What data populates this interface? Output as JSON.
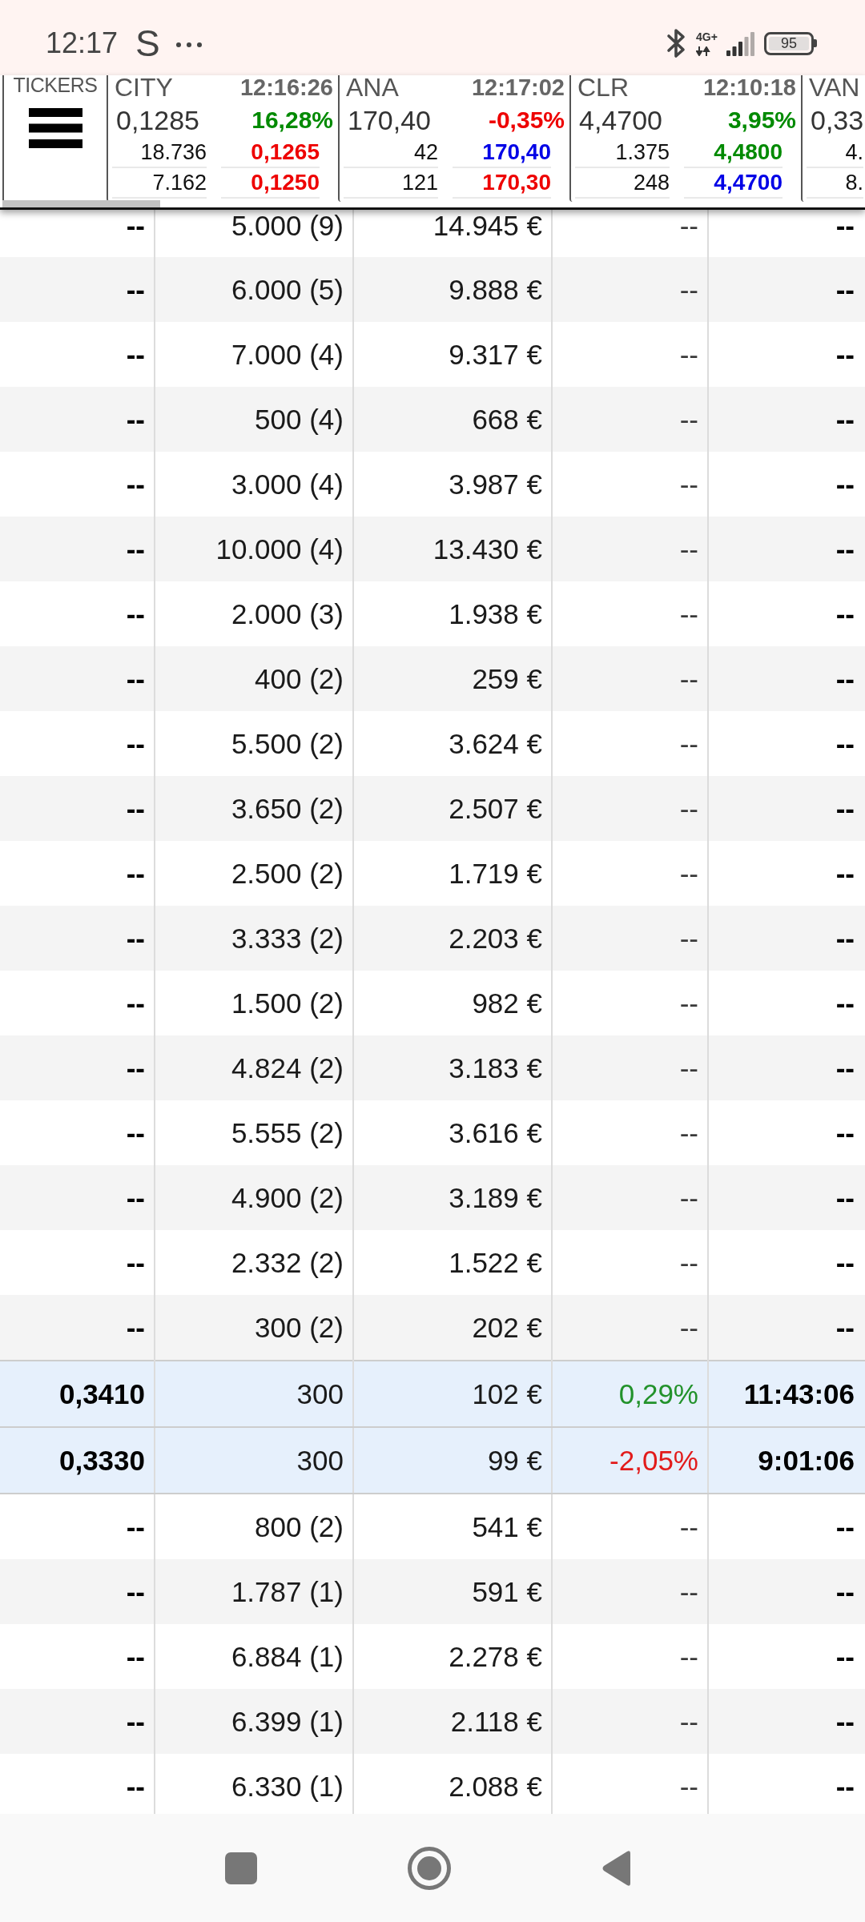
{
  "status_bar": {
    "time": "12:17",
    "notification": "S",
    "network": "4G+",
    "battery": "95"
  },
  "ticker_bar": {
    "label": "TICKERS",
    "tickers": [
      {
        "name": "CITY",
        "time": "12:16:26",
        "price": "0,1285",
        "change": "16,28%",
        "color": "#008a00",
        "levels": [
          {
            "volume": "18.736",
            "price": "0,1265",
            "color": "#ee0000"
          },
          {
            "volume": "7.162",
            "price": "0,1250",
            "color": "#ee0000"
          }
        ]
      },
      {
        "name": "ANA",
        "time": "12:17:02",
        "price": "170,40",
        "change": "-0,35%",
        "color": "#ee0000",
        "levels": [
          {
            "volume": "42",
            "price": "170,40",
            "color": "#0000e6"
          },
          {
            "volume": "121",
            "price": "170,30",
            "color": "#ee0000"
          }
        ]
      },
      {
        "name": "CLR",
        "time": "12:10:18",
        "price": "4,4700",
        "change": "3,95%",
        "color": "#008a00",
        "levels": [
          {
            "volume": "1.375",
            "price": "4,4800",
            "color": "#008a00"
          },
          {
            "volume": "248",
            "price": "4,4700",
            "color": "#0000e6"
          }
        ]
      },
      {
        "name": "VAN",
        "price": "0,33",
        "levels": [
          {
            "volume": "4."
          },
          {
            "volume": "8."
          }
        ]
      }
    ]
  },
  "table": {
    "rows": [
      {
        "highlighted": false,
        "cells": [
          "--",
          "5.000 (9)",
          "14.945 €",
          "--",
          "--"
        ]
      },
      {
        "highlighted": false,
        "cells": [
          "--",
          "6.000 (5)",
          "9.888 €",
          "--",
          "--"
        ]
      },
      {
        "highlighted": false,
        "cells": [
          "--",
          "7.000 (4)",
          "9.317 €",
          "--",
          "--"
        ]
      },
      {
        "highlighted": false,
        "cells": [
          "--",
          "500 (4)",
          "668 €",
          "--",
          "--"
        ]
      },
      {
        "highlighted": false,
        "cells": [
          "--",
          "3.000 (4)",
          "3.987 €",
          "--",
          "--"
        ]
      },
      {
        "highlighted": false,
        "cells": [
          "--",
          "10.000 (4)",
          "13.430 €",
          "--",
          "--"
        ]
      },
      {
        "highlighted": false,
        "cells": [
          "--",
          "2.000 (3)",
          "1.938 €",
          "--",
          "--"
        ]
      },
      {
        "highlighted": false,
        "cells": [
          "--",
          "400 (2)",
          "259 €",
          "--",
          "--"
        ]
      },
      {
        "highlighted": false,
        "cells": [
          "--",
          "5.500 (2)",
          "3.624 €",
          "--",
          "--"
        ]
      },
      {
        "highlighted": false,
        "cells": [
          "--",
          "3.650 (2)",
          "2.507 €",
          "--",
          "--"
        ]
      },
      {
        "highlighted": false,
        "cells": [
          "--",
          "2.500 (2)",
          "1.719 €",
          "--",
          "--"
        ]
      },
      {
        "highlighted": false,
        "cells": [
          "--",
          "3.333 (2)",
          "2.203 €",
          "--",
          "--"
        ]
      },
      {
        "highlighted": false,
        "cells": [
          "--",
          "1.500 (2)",
          "982 €",
          "--",
          "--"
        ]
      },
      {
        "highlighted": false,
        "cells": [
          "--",
          "4.824 (2)",
          "3.183 €",
          "--",
          "--"
        ]
      },
      {
        "highlighted": false,
        "cells": [
          "--",
          "5.555 (2)",
          "3.616 €",
          "--",
          "--"
        ]
      },
      {
        "highlighted": false,
        "cells": [
          "--",
          "4.900 (2)",
          "3.189 €",
          "--",
          "--"
        ]
      },
      {
        "highlighted": false,
        "cells": [
          "--",
          "2.332 (2)",
          "1.522 €",
          "--",
          "--"
        ]
      },
      {
        "highlighted": false,
        "cells": [
          "--",
          "300 (2)",
          "202 €",
          "--",
          "--"
        ]
      },
      {
        "highlighted": true,
        "cells": [
          "0,3410",
          "300",
          "102 €",
          "0,29%",
          "11:43:06"
        ],
        "color": "#22922b"
      },
      {
        "highlighted": true,
        "cells": [
          "0,3330",
          "300",
          "99 €",
          "-2,05%",
          "9:01:06"
        ],
        "color": "#e21b1b"
      },
      {
        "highlighted": false,
        "cells": [
          "--",
          "800 (2)",
          "541 €",
          "--",
          "--"
        ]
      },
      {
        "highlighted": false,
        "cells": [
          "--",
          "1.787 (1)",
          "591 €",
          "--",
          "--"
        ]
      },
      {
        "highlighted": false,
        "cells": [
          "--",
          "6.884 (1)",
          "2.278 €",
          "--",
          "--"
        ]
      },
      {
        "highlighted": false,
        "cells": [
          "--",
          "6.399 (1)",
          "2.118 €",
          "--",
          "--"
        ]
      },
      {
        "highlighted": false,
        "cells": [
          "--",
          "6.330 (1)",
          "2.088 €",
          "--",
          "--"
        ]
      }
    ]
  }
}
